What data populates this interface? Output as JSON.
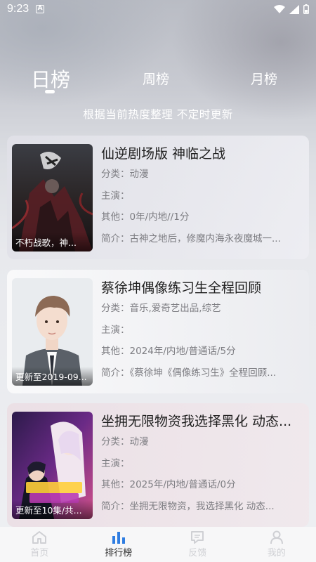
{
  "status": {
    "time": "9:23"
  },
  "tabs": {
    "day": "日榜",
    "week": "周榜",
    "month": "月榜"
  },
  "subtitle": "根据当前热度整理 不定时更新",
  "items": [
    {
      "title": "仙逆剧场版 神临之战",
      "poster_caption": "不朽战歌，神...",
      "category": "分类：动漫",
      "cast": "主演：",
      "other": "其他：0年/内地//1分",
      "intro": "简介：古神之地后，修魔内海永夜魔城一..."
    },
    {
      "title": "蔡徐坤偶像练习生全程回顾",
      "poster_caption": "更新至2019-09...",
      "category": "分类：音乐,爱奇艺出品,综艺",
      "cast": "主演：",
      "other": "其他：2024年/内地/普通话/5分",
      "intro": "简介：《蔡徐坤《偶像练习生》全程回顾..."
    },
    {
      "title": "坐拥无限物资我选择黑化 动态...",
      "poster_caption": "更新至10集/共...",
      "category": "分类：动漫",
      "cast": "主演：",
      "other": "其他：2025年/内地/普通话/0分",
      "intro": "简介：坐拥无限物资，我选择黑化 动态..."
    }
  ],
  "nav": {
    "home": "首页",
    "rank": "排行榜",
    "feedback": "反馈",
    "mine": "我的"
  },
  "colors": {
    "accent_blue": "#2f7de1",
    "nav_inactive": "#cfd0d4"
  }
}
